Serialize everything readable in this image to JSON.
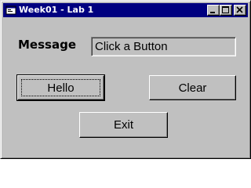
{
  "window": {
    "title": "Week01 - Lab 1",
    "app_icon": "form-icon",
    "controls": {
      "minimize_icon": "minimize-icon",
      "maximize_icon": "maximize-icon",
      "close_icon": "close-icon"
    },
    "colors": {
      "titlebar": "#000080",
      "face": "#c0c0c0"
    }
  },
  "form": {
    "message_label": "Message",
    "message_value": "Click a Button",
    "buttons": {
      "hello": "Hello",
      "clear": "Clear",
      "exit": "Exit"
    }
  }
}
